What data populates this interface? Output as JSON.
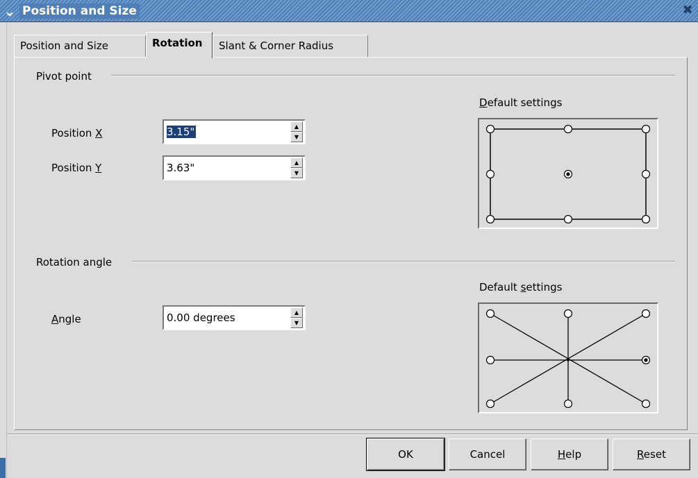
{
  "window": {
    "title": "Position and Size",
    "menu_icon": "chevron-down-icon",
    "close_icon": "close-icon"
  },
  "tabs": [
    {
      "label": "Position and Size",
      "active": false
    },
    {
      "label": "Rotation",
      "active": true
    },
    {
      "label": "Slant & Corner Radius",
      "active": false
    }
  ],
  "pivot": {
    "group_title": "Pivot point",
    "position_x_label": "Position ",
    "position_x_mnemonic": "X",
    "position_x_value": "3.15\"",
    "position_y_label": "Position ",
    "position_y_mnemonic": "Y",
    "position_y_value": "3.63\"",
    "default_settings_mnemonic": "D",
    "default_settings_rest": "efault settings",
    "selected_point": "center"
  },
  "rotation": {
    "group_title": "Rotation angle",
    "angle_mnemonic": "A",
    "angle_rest": "ngle",
    "angle_value": "0.00 degrees",
    "default_settings_pre": "Default ",
    "default_settings_mnemonic": "s",
    "default_settings_rest": "ettings",
    "selected_point": "right-middle"
  },
  "buttons": {
    "ok": "OK",
    "cancel": "Cancel",
    "help_mnemonic": "H",
    "help_rest": "elp",
    "reset_mnemonic": "R",
    "reset_rest": "eset"
  }
}
